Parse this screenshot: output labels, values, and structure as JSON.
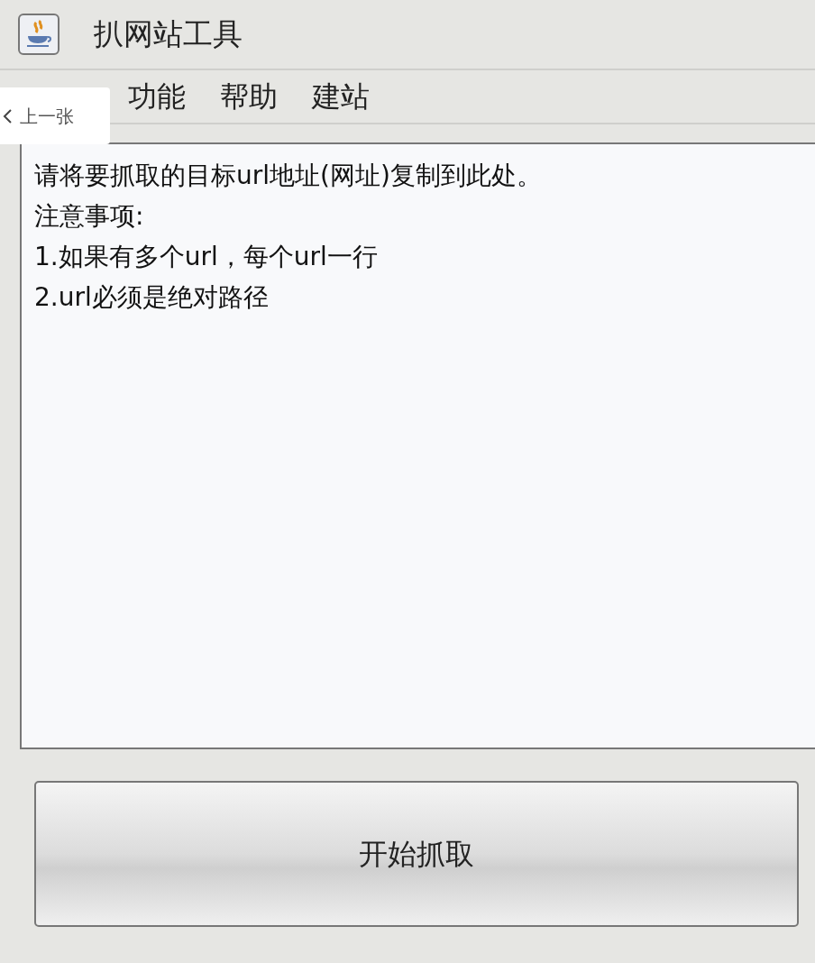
{
  "window": {
    "title": "扒网站工具"
  },
  "menu": [
    "功能",
    "帮助",
    "建站"
  ],
  "text_area": {
    "lines": [
      "请将要抓取的目标url地址(网址)复制到此处。",
      "注意事项:",
      "1.如果有多个url，每个url一行",
      "2.url必须是绝对路径"
    ]
  },
  "button": "开始抓取",
  "overlay": {
    "label": "上一张"
  }
}
